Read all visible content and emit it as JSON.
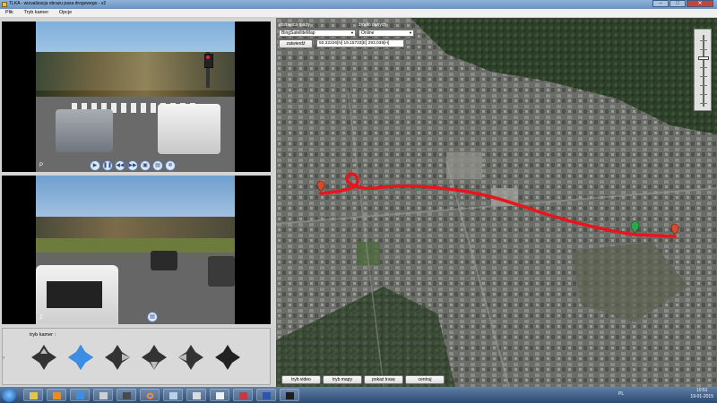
{
  "window": {
    "title": "TLKA - wizualizacja obrazu pasa drogowego - v2",
    "minimize": "–",
    "maximize": "□",
    "close": "✕"
  },
  "menu": [
    "Plik",
    "Tryb kamer",
    "Opcje"
  ],
  "cameras": {
    "top_label": "P",
    "bottom_label": "Z",
    "controls": [
      {
        "name": "play-icon",
        "glyph": "▶"
      },
      {
        "name": "pause-icon",
        "glyph": "❚❚"
      },
      {
        "name": "rewind-icon",
        "glyph": "◀◀"
      },
      {
        "name": "forward-icon",
        "glyph": "▶▶"
      },
      {
        "name": "camera-switch-icon",
        "glyph": "▣"
      },
      {
        "name": "screenshot-icon",
        "glyph": "▤"
      },
      {
        "name": "settings-icon",
        "glyph": "✲"
      }
    ],
    "zoom_icon": "▤"
  },
  "camera_mode": {
    "label": "tryb kamer :",
    "side_arrow": "›",
    "selected_index": 1
  },
  "map": {
    "provider_label": "dostawca mapy",
    "provider_value": "BingSatelliteMap",
    "source_label": "źródło danych",
    "source_value": "Online",
    "apply_button": "zatwierdź",
    "coords": "50,32226[N] 19,15733[E] 293,039[H]",
    "bottom_buttons": [
      "tryb video",
      "tryb mapy",
      "pokaż trasę",
      "centruj"
    ],
    "route_color": "#e8161c",
    "marker_start_color": "#d84a2c",
    "marker_current_color": "#2ea84a"
  },
  "taskbar": {
    "apps": [
      "explorer",
      "media-player",
      "music",
      "window-manager",
      "chrome",
      "notepad",
      "office",
      "pdf",
      "word",
      "terminal"
    ],
    "lang": "PL",
    "time": "10:51",
    "date": "19-01-2015"
  }
}
